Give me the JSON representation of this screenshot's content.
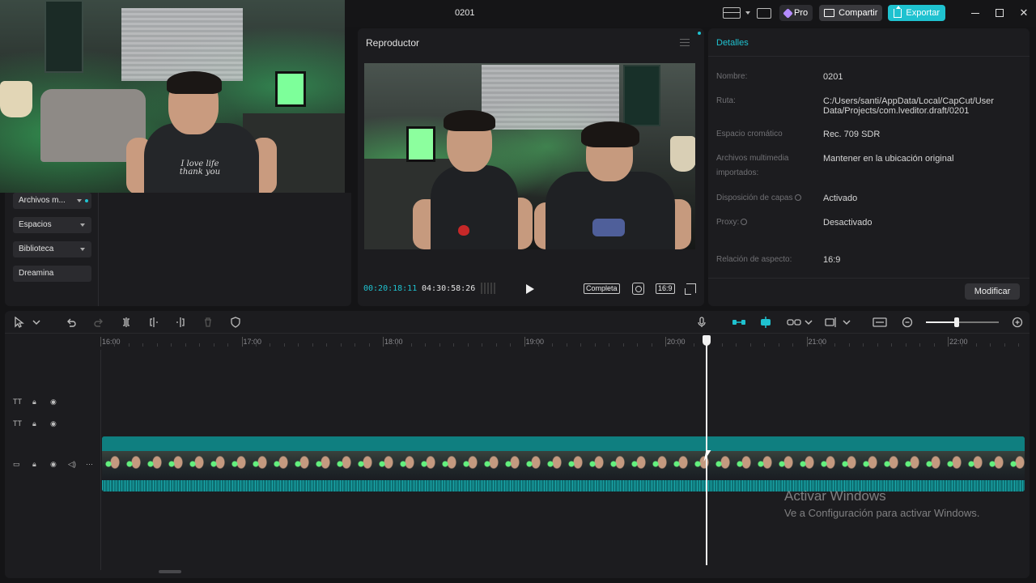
{
  "window": {
    "title": "0201",
    "pro_label": "Pro",
    "share_label": "Compartir",
    "export_label": "Exportar",
    "accent_color": "#1fc2d0"
  },
  "webcam": {
    "shirt_text": "I love life thank you"
  },
  "media_nav": {
    "items": [
      {
        "label": "Archivos m...",
        "icon": "chevron-down-icon"
      },
      {
        "label": "Espacios",
        "icon": "chevron-down-icon"
      },
      {
        "label": "Biblioteca",
        "icon": "chevron-down-icon"
      },
      {
        "label": "Dreamina",
        "icon": ""
      }
    ]
  },
  "player": {
    "title": "Reproductor",
    "current_time": "00:20:18:11",
    "total_time": "04:30:58:26",
    "full_label": "Completa",
    "ratio_label": "16:9"
  },
  "details": {
    "title": "Detalles",
    "rows": [
      {
        "label": "Nombre:",
        "value": "0201"
      },
      {
        "label": "Ruta:",
        "value": "C:/Users/santi/AppData/Local/CapCut/User Data/Projects/com.lveditor.draft/0201"
      },
      {
        "label": "Espacio cromático",
        "value": "Rec. 709 SDR"
      },
      {
        "label": "Archivos multimedia importados:",
        "value": "Mantener en la ubicación original"
      },
      {
        "label": "Disposición de capas",
        "value": "Activado"
      },
      {
        "label": "Proxy:",
        "value": "Desactivado"
      },
      {
        "label": "Relación de aspecto:",
        "value": "16:9"
      }
    ],
    "modify_label": "Modificar"
  },
  "timeline": {
    "ruler_labels": [
      "16:00",
      "17:00",
      "18:00",
      "19:00",
      "20:00",
      "21:00",
      "22:00"
    ],
    "zoom_level": 0.42
  },
  "watermark": {
    "title": "Activar Windows",
    "subtitle": "Ve a Configuración para activar Windows."
  }
}
